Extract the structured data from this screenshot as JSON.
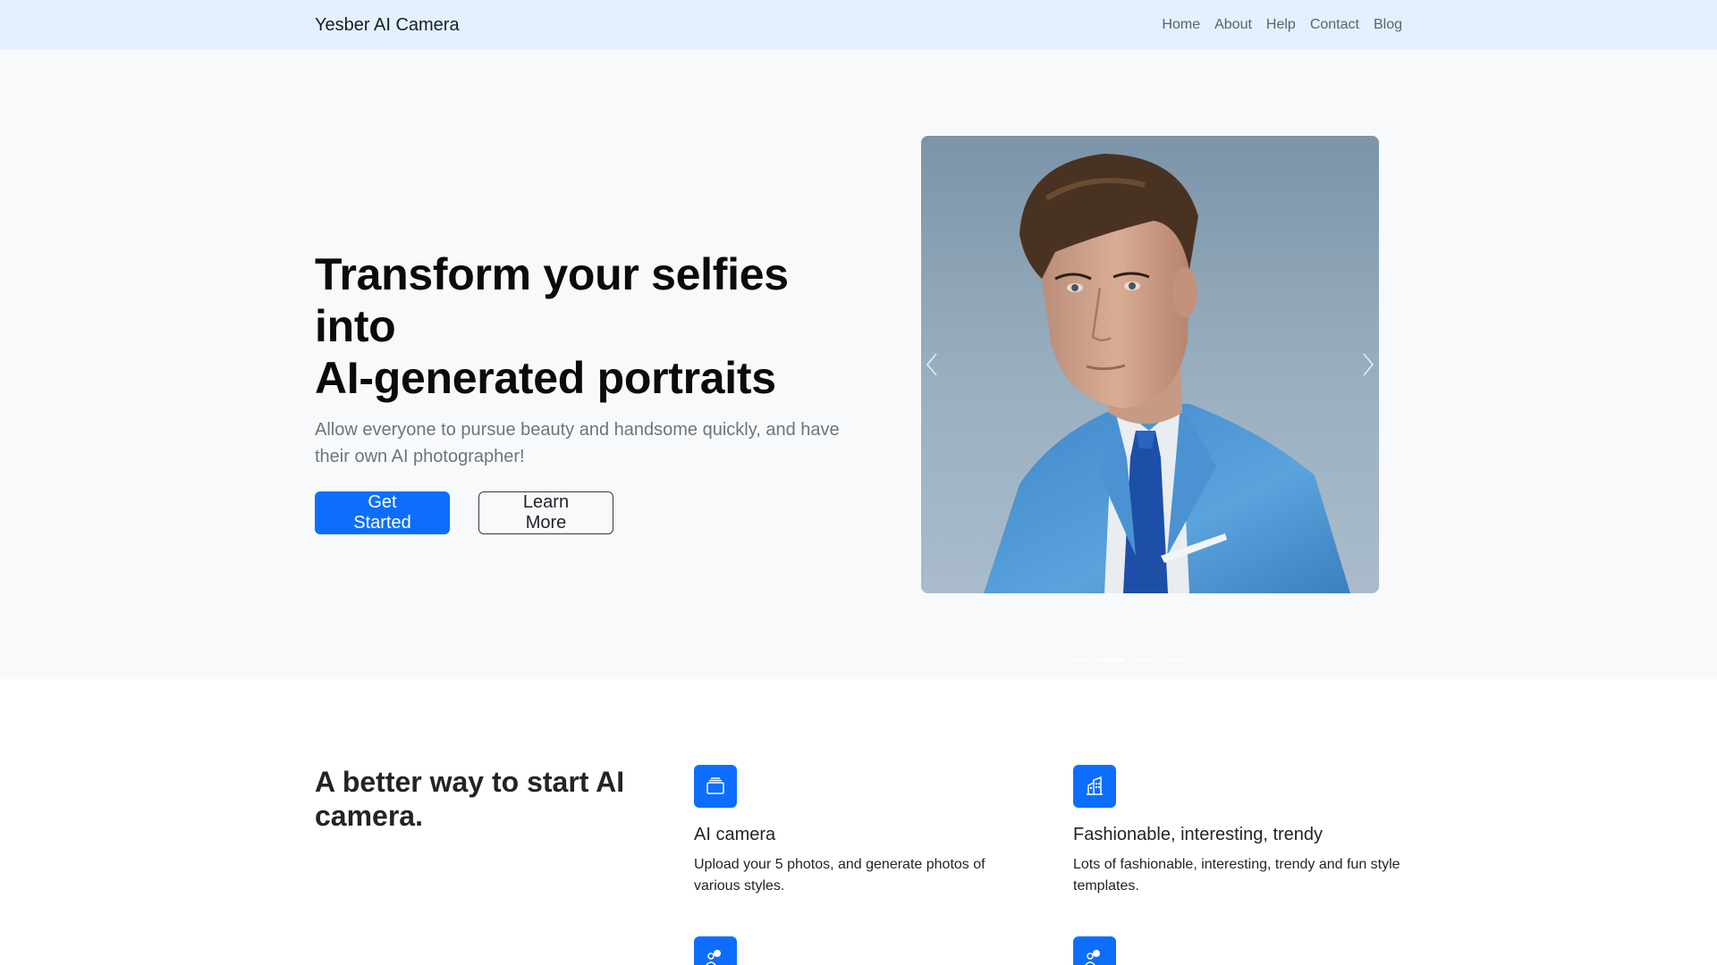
{
  "nav": {
    "brand": "Yesber AI Camera",
    "links": [
      "Home",
      "About",
      "Help",
      "Contact",
      "Blog"
    ]
  },
  "hero": {
    "title_line1": "Transform your selfies into",
    "title_line2": "AI-generated portraits",
    "subtitle": "Allow everyone to pursue beauty and handsome quickly, and have their own AI photographer!",
    "primary_button": "Get Started",
    "secondary_button": "Learn More",
    "carousel": {
      "slide_count": 4,
      "active_index": 1
    }
  },
  "features": {
    "heading": "A better way to start AI camera.",
    "items": [
      {
        "icon": "collection-icon",
        "title": "AI camera",
        "description": "Upload your 5 photos, and generate photos of various styles."
      },
      {
        "icon": "building-icon",
        "title": "Fashionable, interesting, trendy",
        "description": "Lots of fashionable, interesting, trendy and fun style templates."
      },
      {
        "icon": "people-icon",
        "title": "",
        "description": ""
      },
      {
        "icon": "people-icon",
        "title": "",
        "description": ""
      }
    ]
  },
  "colors": {
    "navbar_bg": "#e3f0fd",
    "primary": "#0d6efd",
    "hero_bg": "#f8f9fa"
  }
}
